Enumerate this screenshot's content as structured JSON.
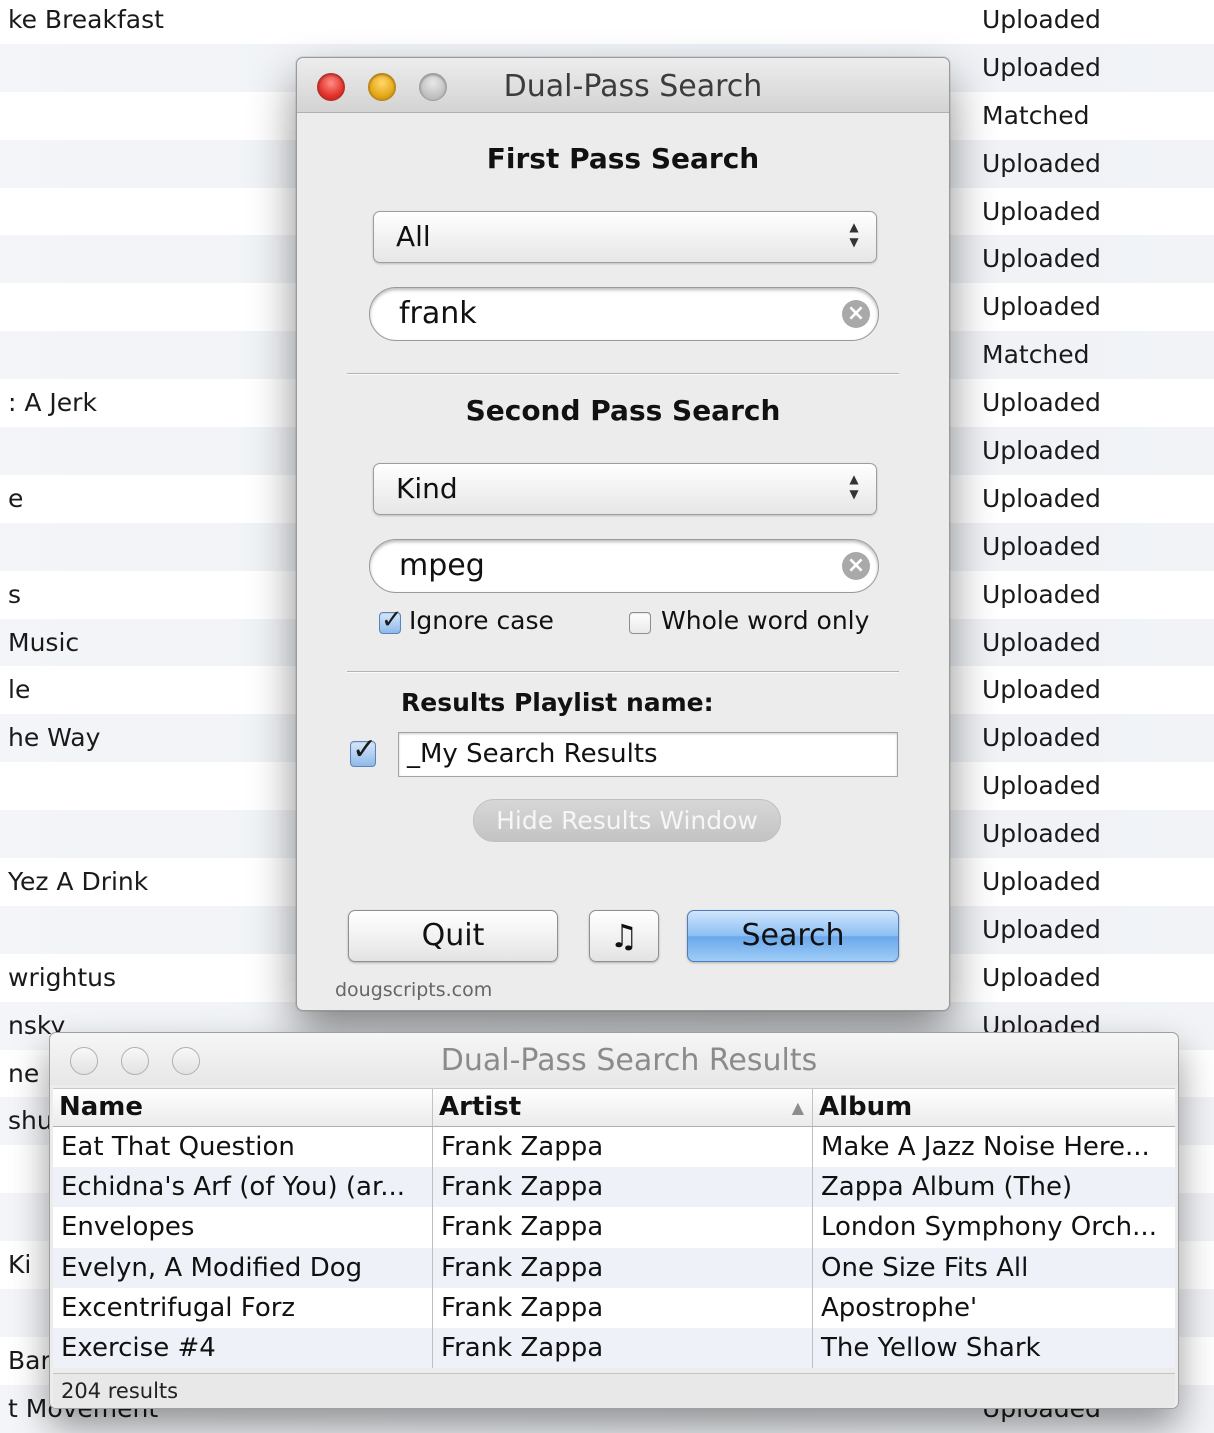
{
  "background_list": {
    "rows": [
      {
        "left": "ke Breakfast",
        "right": "Uploaded"
      },
      {
        "left": "",
        "right": "Uploaded"
      },
      {
        "left": "",
        "right": "Matched"
      },
      {
        "left": "",
        "right": "Uploaded"
      },
      {
        "left": "",
        "right": "Uploaded"
      },
      {
        "left": "",
        "right": "Uploaded"
      },
      {
        "left": "",
        "right": "Uploaded"
      },
      {
        "left": "",
        "right": "Matched"
      },
      {
        "left": ": A Jerk",
        "right": "Uploaded"
      },
      {
        "left": "",
        "right": "Uploaded"
      },
      {
        "left": "e",
        "right": "Uploaded"
      },
      {
        "left": "",
        "right": "Uploaded"
      },
      {
        "left": "s",
        "right": "Uploaded"
      },
      {
        "left": "Music",
        "right": "Uploaded"
      },
      {
        "left": "le",
        "right": "Uploaded"
      },
      {
        "left": "he Way",
        "right": "Uploaded"
      },
      {
        "left": "",
        "right": "Uploaded"
      },
      {
        "left": "",
        "right": "Uploaded"
      },
      {
        "left": "Yez A Drink",
        "right": "Uploaded"
      },
      {
        "left": "",
        "right": "Uploaded"
      },
      {
        "left": "wrightus",
        "right": "Uploaded"
      },
      {
        "left": "nsky",
        "right": "Uploaded"
      },
      {
        "left": "ne !",
        "right": ""
      },
      {
        "left": "shu",
        "right": ""
      },
      {
        "left": "",
        "right": ""
      },
      {
        "left": "",
        "right": ""
      },
      {
        "left": "Ki",
        "right": ""
      },
      {
        "left": "",
        "right": ""
      },
      {
        "left": "Bar",
        "right": ""
      },
      {
        "left": "t Movement",
        "right": "Uploaded"
      }
    ]
  },
  "main_window": {
    "title": "Dual-Pass Search",
    "first_pass": {
      "heading": "First Pass Search",
      "field_select": "All",
      "search_value": "frank"
    },
    "second_pass": {
      "heading": "Second Pass Search",
      "field_select": "Kind",
      "search_value": "mpeg"
    },
    "options": {
      "ignore_case_label": "Ignore case",
      "ignore_case_checked": true,
      "whole_word_label": "Whole word only",
      "whole_word_checked": false
    },
    "results_playlist": {
      "label": "Results Playlist name:",
      "enabled": true,
      "name_value": "_My Search Results"
    },
    "hide_results_label": "Hide Results Window",
    "quit_label": "Quit",
    "music_icon": "music-note-icon",
    "search_label": "Search",
    "brand": "dougscripts.com"
  },
  "results_window": {
    "title": "Dual-Pass Search Results",
    "columns": [
      "Name",
      "Artist",
      "Album"
    ],
    "rows": [
      {
        "name": "Eat That Question",
        "artist": "Frank Zappa",
        "album": "Make A Jazz Noise Here..."
      },
      {
        "name": "Echidna's Arf (of You) (ar...",
        "artist": "Frank Zappa",
        "album": "Zappa Album (The)"
      },
      {
        "name": "Envelopes",
        "artist": "Frank Zappa",
        "album": "London Symphony Orch..."
      },
      {
        "name": "Evelyn, A Modified Dog",
        "artist": "Frank Zappa",
        "album": "One Size Fits All"
      },
      {
        "name": "Excentrifugal Forz",
        "artist": "Frank Zappa",
        "album": "Apostrophe'"
      },
      {
        "name": "Exercise #4",
        "artist": "Frank Zappa",
        "album": "The Yellow Shark"
      }
    ],
    "status": "204 results"
  },
  "colors": {
    "accent_blue": "#6aa7ea",
    "close_red": "#e2332a",
    "minimize_yellow": "#e5a81a"
  }
}
